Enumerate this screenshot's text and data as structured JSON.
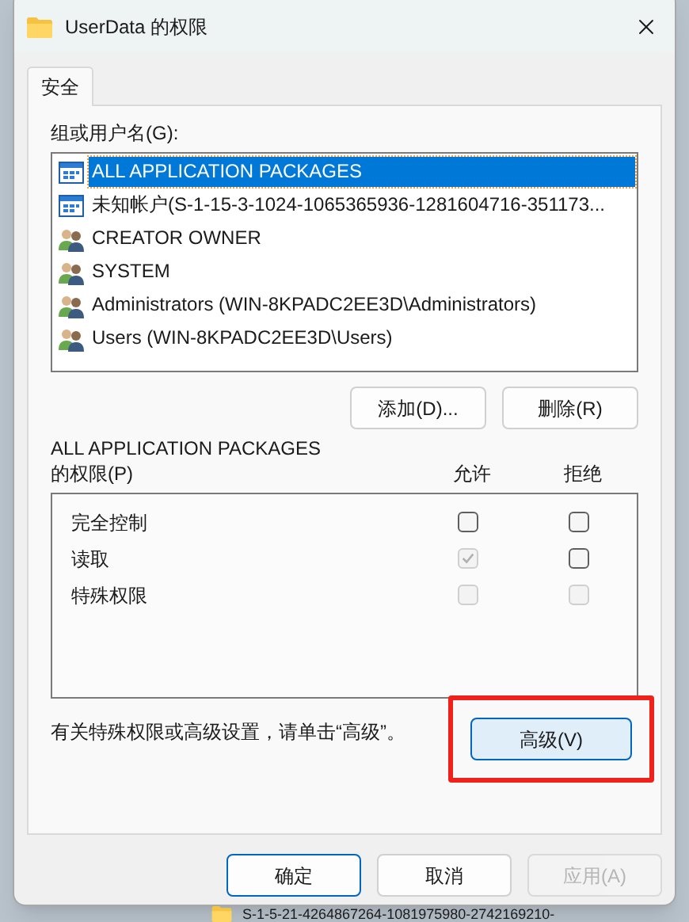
{
  "window": {
    "title": "UserData 的权限"
  },
  "tabs": [
    {
      "label": "安全",
      "selected": true
    }
  ],
  "principals": {
    "label": "组或用户名(G):",
    "items": [
      {
        "name": "ALL APPLICATION PACKAGES",
        "kind": "package",
        "selected": true
      },
      {
        "name": "未知帐户(S-1-15-3-1024-1065365936-1281604716-351173...",
        "kind": "package",
        "selected": false
      },
      {
        "name": "CREATOR OWNER",
        "kind": "group",
        "selected": false
      },
      {
        "name": "SYSTEM",
        "kind": "group",
        "selected": false
      },
      {
        "name": "Administrators (WIN-8KPADC2EE3D\\Administrators)",
        "kind": "group",
        "selected": false
      },
      {
        "name": "Users (WIN-8KPADC2EE3D\\Users)",
        "kind": "group",
        "selected": false
      }
    ]
  },
  "principal_buttons": [
    "添加(D)...",
    "删除(R)"
  ],
  "permissions": {
    "title": "ALL APPLICATION PACKAGES",
    "label": "的权限(P)",
    "columns": [
      "允许",
      "拒绝"
    ],
    "rows": [
      {
        "name": "完全控制",
        "allow": {
          "checked": false,
          "disabled": false
        },
        "deny": {
          "checked": false,
          "disabled": false
        }
      },
      {
        "name": "读取",
        "allow": {
          "checked": true,
          "disabled": true
        },
        "deny": {
          "checked": false,
          "disabled": false
        }
      },
      {
        "name": "特殊权限",
        "allow": {
          "checked": false,
          "disabled": true
        },
        "deny": {
          "checked": false,
          "disabled": true
        }
      }
    ]
  },
  "advanced": {
    "hint": "有关特殊权限或高级设置，请单击“高级”。",
    "button": "高级(V)",
    "highlighted": true
  },
  "footer_buttons": [
    {
      "label": "确定",
      "kind": "default",
      "disabled": false
    },
    {
      "label": "取消",
      "kind": "normal",
      "disabled": false
    },
    {
      "label": "应用(A)",
      "kind": "normal",
      "disabled": true
    }
  ],
  "background": {
    "text": "S-1-5-21-4264867264-1081975980-2742169210-"
  }
}
